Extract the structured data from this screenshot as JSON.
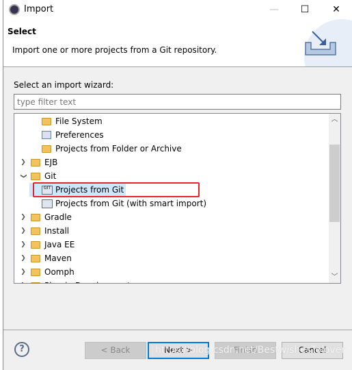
{
  "window": {
    "title": "Import",
    "controls": [
      "minimize",
      "maximize",
      "close"
    ]
  },
  "header": {
    "title": "Select",
    "description": "Import one or more projects from a Git repository."
  },
  "label": "Select an import wizard:",
  "filter": {
    "placeholder": "type filter text",
    "value": ""
  },
  "tree": [
    {
      "label": "File System",
      "icon": "folder-icon",
      "indent": 2
    },
    {
      "label": "Preferences",
      "icon": "preferences-icon",
      "indent": 2
    },
    {
      "label": "Projects from Folder or Archive",
      "icon": "folder-icon",
      "indent": 2
    },
    {
      "label": "EJB",
      "icon": "folder-icon",
      "indent": 1,
      "toggle": "collapsed"
    },
    {
      "label": "Git",
      "icon": "folder-icon",
      "indent": 1,
      "toggle": "expanded"
    },
    {
      "label": "Projects from Git",
      "icon": "git-icon",
      "indent": 2,
      "selected": true
    },
    {
      "label": "Projects from Git (with smart import)",
      "icon": "git-import-icon",
      "indent": 2
    },
    {
      "label": "Gradle",
      "icon": "folder-icon",
      "indent": 1,
      "toggle": "collapsed"
    },
    {
      "label": "Install",
      "icon": "folder-icon",
      "indent": 1,
      "toggle": "collapsed"
    },
    {
      "label": "Java EE",
      "icon": "folder-icon",
      "indent": 1,
      "toggle": "collapsed"
    },
    {
      "label": "Maven",
      "icon": "folder-icon",
      "indent": 1,
      "toggle": "collapsed"
    },
    {
      "label": "Oomph",
      "icon": "folder-icon",
      "indent": 1,
      "toggle": "collapsed"
    },
    {
      "label": "Plug-in Development",
      "icon": "folder-icon",
      "indent": 1,
      "toggle": "collapsed"
    }
  ],
  "buttons": {
    "back": "< Back",
    "next": "Next >",
    "finish": "Finish",
    "cancel": "Cancel"
  },
  "watermark": "https://blog.csdn.net/BestwishesTolover",
  "colors": {
    "highlight_box": "#e8242b",
    "selection": "#cce8ff",
    "default_button": "#0078d7"
  }
}
